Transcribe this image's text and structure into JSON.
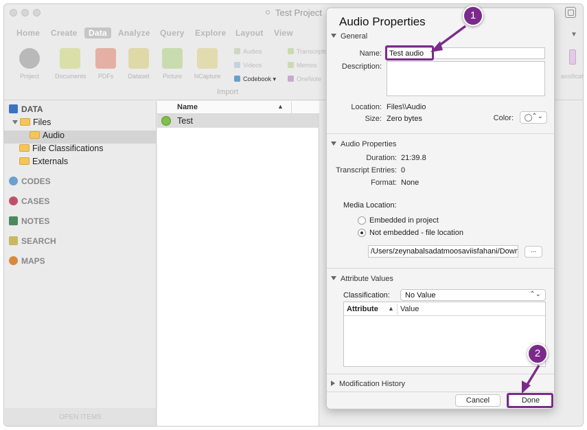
{
  "titlebar": {
    "title": "Test Project"
  },
  "ribbon": {
    "tabs": [
      "Home",
      "Create",
      "Data",
      "Analyze",
      "Query",
      "Explore",
      "Layout",
      "View"
    ],
    "buttons": [
      {
        "label": "Project",
        "icon": "project-icon"
      },
      {
        "label": "Documents",
        "icon": "documents-icon"
      },
      {
        "label": "PDFs",
        "icon": "pdf-icon"
      },
      {
        "label": "Dataset",
        "icon": "dataset-icon"
      },
      {
        "label": "Picture",
        "icon": "picture-icon"
      },
      {
        "label": "NCapture",
        "icon": "ncapture-icon"
      }
    ],
    "small_buttons": [
      "Audios",
      "Videos",
      "Codebook",
      "Transcripts",
      "Memos",
      "OneNote"
    ],
    "group_label": "Import",
    "right_label": "assificat"
  },
  "sidebar": {
    "data_header": "DATA",
    "tree": [
      "Files",
      "Audio",
      "File Classifications",
      "Externals"
    ],
    "sections": [
      "CODES",
      "CASES",
      "NOTES",
      "SEARCH",
      "MAPS"
    ],
    "open_items": "OPEN ITEMS"
  },
  "list": {
    "column_name": "Name",
    "rows": [
      "Test"
    ]
  },
  "panel": {
    "title": "Audio Properties",
    "general": {
      "header": "General",
      "name_label": "Name:",
      "name_value": "Test audio",
      "description_label": "Description:",
      "location_label": "Location:",
      "location_value": "Files\\\\Audio",
      "size_label": "Size:",
      "size_value": "Zero bytes",
      "color_label": "Color:"
    },
    "audio": {
      "header": "Audio Properties",
      "duration_label": "Duration:",
      "duration_value": "21:39.8",
      "transcript_label": "Transcript Entries:",
      "transcript_value": "0",
      "format_label": "Format:",
      "format_value": "None",
      "media_location_label": "Media Location:",
      "option_embedded": "Embedded in project",
      "option_not_embedded": "Not embedded - file location",
      "file_path": "/Users/zeynabalsadatmoosaviisfahani/Down",
      "browse_label": "..."
    },
    "attributes": {
      "header": "Attribute Values",
      "classification_label": "Classification:",
      "classification_value": "No Value",
      "col_attribute": "Attribute",
      "col_value": "Value"
    },
    "history": {
      "header": "Modification History"
    },
    "cancel_label": "Cancel",
    "done_label": "Done"
  },
  "annotations": {
    "step1": "1",
    "step2": "2",
    "color": "#7b2a8c"
  }
}
